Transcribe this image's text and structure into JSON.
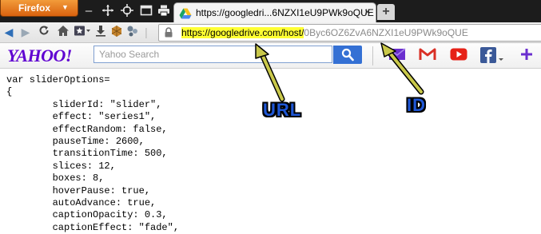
{
  "browser": {
    "menu_button": "Firefox",
    "tab_title": "https://googledri...6NZXI1eU9PWk9oQUE",
    "tab_close": "×",
    "new_tab": "+"
  },
  "address_bar": {
    "url_highlighted": "https://googledrive.com/host/",
    "url_rest": "0Byc6OZ6ZvA6NZXI1eU9PWk9oQUE"
  },
  "yahoo_toolbar": {
    "logo": "YAHOO!",
    "search_placeholder": "Yahoo Search",
    "icons": [
      "search-icon",
      "mail-icon",
      "gmail-icon",
      "youtube-icon",
      "facebook-icon",
      "plus-icon"
    ],
    "brand_color": "#5f01d1",
    "search_button_color": "#3470d4"
  },
  "page": {
    "code": "var sliderOptions=\n{\n        sliderId: \"slider\",\n        effect: \"series1\",\n        effectRandom: false,\n        pauseTime: 2600,\n        transitionTime: 500,\n        slices: 12,\n        boxes: 8,\n        hoverPause: true,\n        autoAdvance: true,\n        captionOpacity: 0.3,\n        captionEffect: \"fade\","
  },
  "annotations": {
    "url_label": "URL",
    "id_label": "ID",
    "label_color": "#1f57d6",
    "arrow_color": "#c9c84a"
  }
}
